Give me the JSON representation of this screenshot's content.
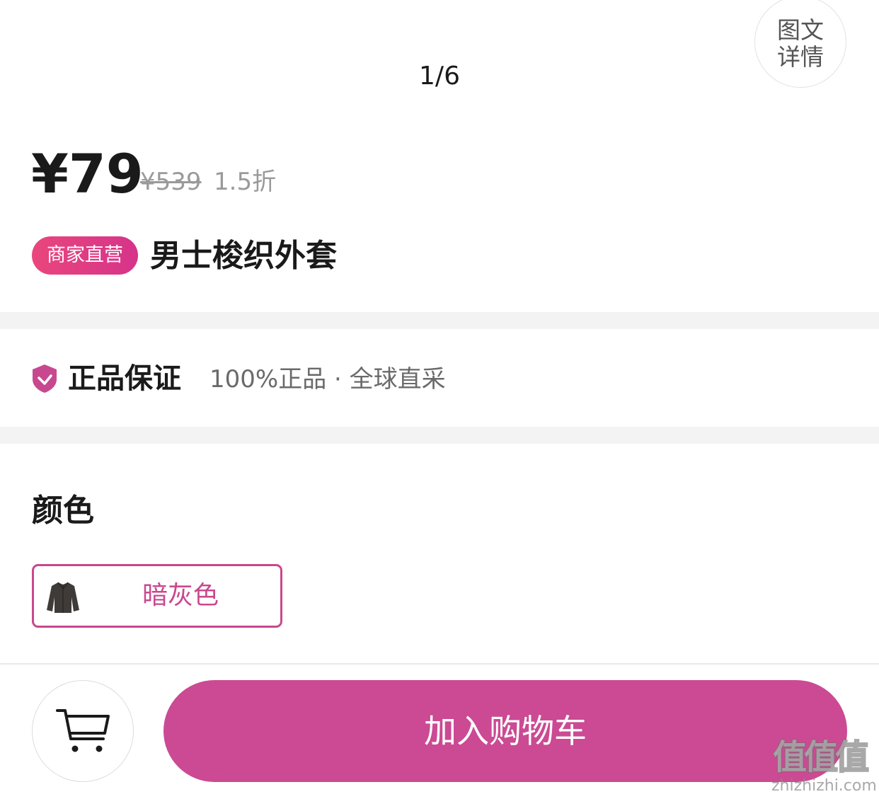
{
  "gallery": {
    "pager": "1/6",
    "detail_button_line1": "图文",
    "detail_button_line2": "详情"
  },
  "price": {
    "current": "¥79",
    "original": "¥539",
    "discount": "1.5折"
  },
  "product": {
    "badge": "商家直营",
    "title": "男士梭织外套"
  },
  "guarantee": {
    "title": "正品保证",
    "description": "100%正品 · 全球直采",
    "icon": "shield-check-icon"
  },
  "variant": {
    "label": "颜色",
    "options": [
      {
        "label": "暗灰色",
        "icon": "jacket-thumbnail-icon",
        "selected": true
      }
    ]
  },
  "actions": {
    "cart_icon": "cart-icon",
    "add_to_cart": "加入购物车"
  },
  "watermark": {
    "logo": "值值值",
    "url": "zhizhizhi.com"
  },
  "colors": {
    "accent": "#cb4a93",
    "badge_gradient_start": "#e9467d",
    "badge_gradient_end": "#d6338a",
    "divider": "#f3f3f3",
    "muted_text": "#9a9a9a"
  }
}
